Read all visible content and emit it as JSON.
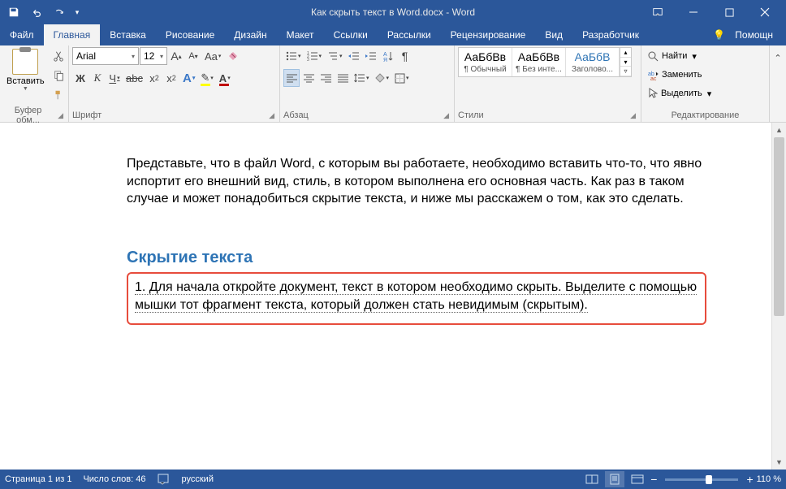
{
  "titlebar": {
    "title": "Как скрыть текст в Word.docx - Word"
  },
  "tabs": {
    "file": "Файл",
    "home": "Главная",
    "insert": "Вставка",
    "draw": "Рисование",
    "design": "Дизайн",
    "layout": "Макет",
    "references": "Ссылки",
    "mailings": "Рассылки",
    "review": "Рецензирование",
    "view": "Вид",
    "developer": "Разработчик",
    "help": "Помощн"
  },
  "ribbon": {
    "clipboard": {
      "label": "Буфер обм...",
      "paste": "Вставить"
    },
    "font": {
      "label": "Шрифт",
      "name": "Arial",
      "size": "12",
      "grow": "A",
      "shrink": "A",
      "case": "Aa",
      "bold": "Ж",
      "italic": "К",
      "underline": "Ч",
      "strike": "abc",
      "sub": "x",
      "sup": "x",
      "effects": "A",
      "highlight_color": "#ffff00",
      "font_color": "#c00000"
    },
    "paragraph": {
      "label": "Абзац"
    },
    "styles": {
      "label": "Стили",
      "items": [
        {
          "preview": "АаБбВв",
          "name": "¶ Обычный",
          "color": "#000"
        },
        {
          "preview": "АаБбВв",
          "name": "¶ Без инте...",
          "color": "#000"
        },
        {
          "preview": "АаБбВ",
          "name": "Заголово...",
          "color": "#2e74b5"
        }
      ]
    },
    "editing": {
      "label": "Редактирование",
      "find": "Найти",
      "replace": "Заменить",
      "select": "Выделить"
    }
  },
  "document": {
    "para1": "Представьте, что в файл Word, с которым вы работаете, необходимо вставить что-то, что явно испортит его внешний вид, стиль, в котором выполнена его основная часть. Как раз в таком случае и может понадобиться скрытие текста, и ниже мы расскажем о том, как это сделать.",
    "heading": "Скрытие текста",
    "selected": "1. Для начала откройте документ, текст в котором необходимо скрыть. Выделите с помощью мышки тот фрагмент текста, который должен стать невидимым (скрытым)."
  },
  "statusbar": {
    "page": "Страница 1 из 1",
    "words": "Число слов: 46",
    "lang": "русский",
    "zoom": "110 %"
  }
}
